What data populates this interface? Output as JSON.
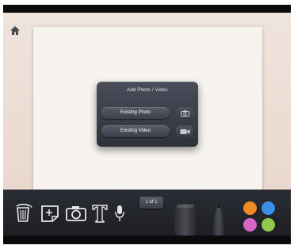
{
  "popup": {
    "title": "Add Photo / Video",
    "existing_photo_label": "Existing Photo",
    "existing_video_label": "Existing Video"
  },
  "toolbar": {
    "page_indicator": "1 of 1"
  },
  "icons": {
    "home": "home-icon",
    "trash": "trash-icon",
    "add_note": "add-note-icon",
    "camera": "camera-icon",
    "text": "text-icon",
    "microphone": "microphone-icon",
    "eraser": "eraser-tool",
    "pen": "pen-tool"
  },
  "colors": {
    "swatches": [
      "#f08a24",
      "#3b8fe6",
      "#d765c6",
      "#8ec94b"
    ]
  }
}
